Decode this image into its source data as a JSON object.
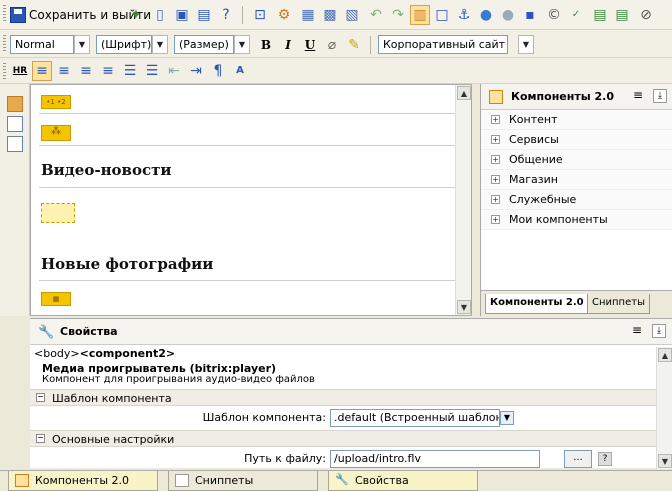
{
  "toolbar": {
    "save_label": "Сохранить и выйти",
    "style_select": "Normal",
    "font_select": "(Шрифт)",
    "size_select": "(Размер)",
    "template_select": "Корпоративный сайт",
    "bold": "B",
    "italic": "I",
    "underline": "U",
    "hr": "HR"
  },
  "editor": {
    "component_ph_1": "•1 •2",
    "heading_1": "Видео-новости",
    "heading_2": "Новые фотографии"
  },
  "components_panel": {
    "title": "Компоненты 2.0",
    "items": [
      {
        "label": "Контент"
      },
      {
        "label": "Сервисы"
      },
      {
        "label": "Общение"
      },
      {
        "label": "Магазин"
      },
      {
        "label": "Служебные"
      },
      {
        "label": "Мои компоненты"
      }
    ],
    "tab_components": "Компоненты 2.0",
    "tab_snippets": "Сниппеты"
  },
  "properties": {
    "title": "Свойства",
    "path_body": "<body>",
    "path_component": "<component2>",
    "component_name": "Медиа проигрыватель (bitrix:player)",
    "component_desc": "Компонент для проигрывания аудио-видео файлов",
    "section_template": "Шаблон компонента",
    "template_label": "Шаблон компонента:",
    "template_value": ".default (Встроенный шаблон)",
    "section_main": "Основные настройки",
    "path_label": "Путь к файлу:",
    "path_value": "/upload/intro.flv",
    "browse_label": "..."
  },
  "bottom_tabs": [
    {
      "label": "Компоненты 2.0"
    },
    {
      "label": "Сниппеты"
    },
    {
      "label": "Свойства"
    }
  ]
}
